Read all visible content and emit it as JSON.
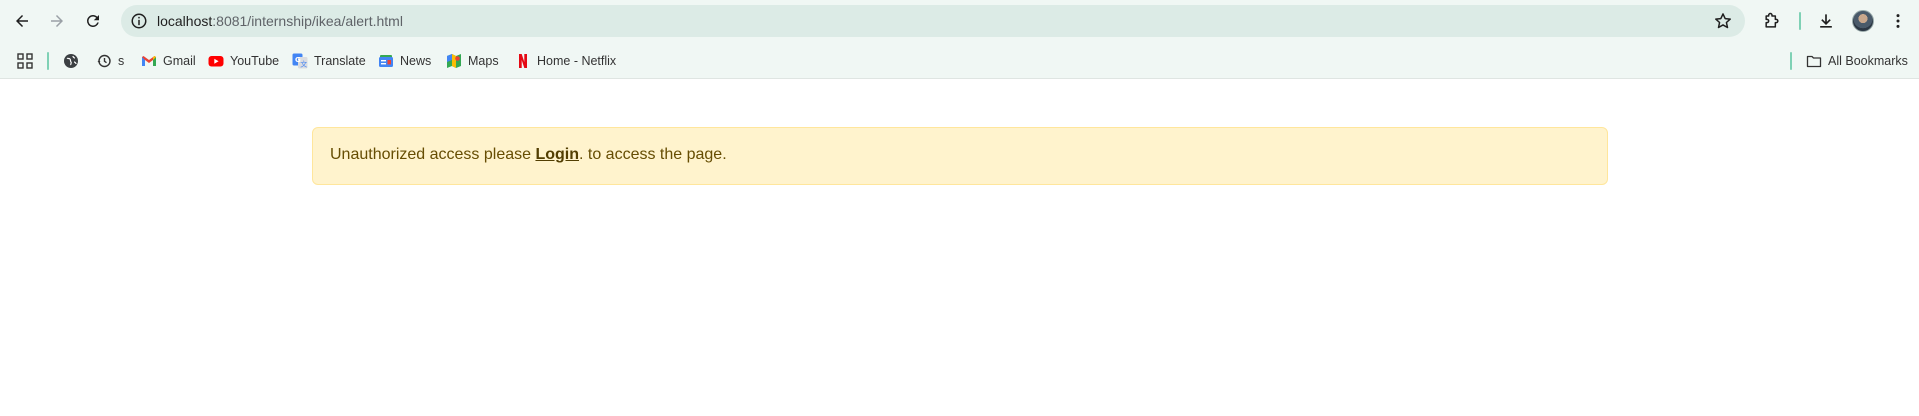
{
  "browser": {
    "url_host": "localhost",
    "url_rest": ":8081/internship/ikea/alert.html"
  },
  "bookmarks": {
    "items": [
      {
        "label": "s",
        "icon": "history-icon"
      },
      {
        "label": "Gmail",
        "icon": "gmail-icon"
      },
      {
        "label": "YouTube",
        "icon": "youtube-icon"
      },
      {
        "label": "Translate",
        "icon": "translate-icon"
      },
      {
        "label": "News",
        "icon": "news-icon"
      },
      {
        "label": "Maps",
        "icon": "maps-icon"
      },
      {
        "label": "Home - Netflix",
        "icon": "netflix-icon"
      }
    ],
    "all_bookmarks_label": "All Bookmarks"
  },
  "alert": {
    "text_before": "Unauthorized access please ",
    "link_label": "Login",
    "text_after": ". to access the page."
  },
  "colors": {
    "alert_bg": "#fff3cd",
    "alert_border": "#ffe69c",
    "alert_text": "#664d03",
    "toolbar_bg": "#f0f7f4",
    "omnibox_bg": "#dcebe6"
  }
}
